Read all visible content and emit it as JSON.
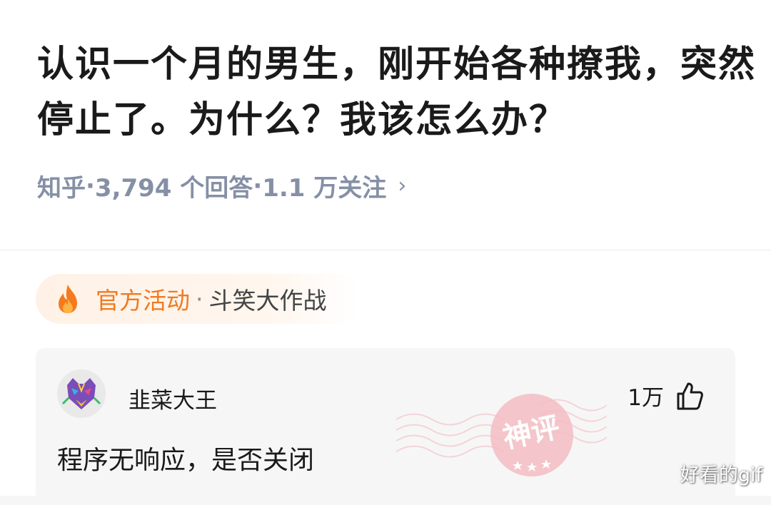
{
  "question": {
    "title": "认识一个月的男生，刚开始各种撩我，突然停止了。为什么？我该怎么办？",
    "source": "知乎",
    "answers": "3,794 个回答",
    "followers": "1.1 万关注",
    "sep": "·",
    "chevron": "›"
  },
  "activity": {
    "icon": "fire-icon",
    "label": "官方活动",
    "sep": "·",
    "name": "斗笑大作战",
    "accent_color": "#f07a21"
  },
  "comment": {
    "author": "韭菜大王",
    "likes": "1万",
    "like_icon": "thumbs-up-icon",
    "text": "程序无响应，是否关闭",
    "badge": "神评",
    "badge_color": "#f3b6bd"
  },
  "watermark": "好看的gif"
}
